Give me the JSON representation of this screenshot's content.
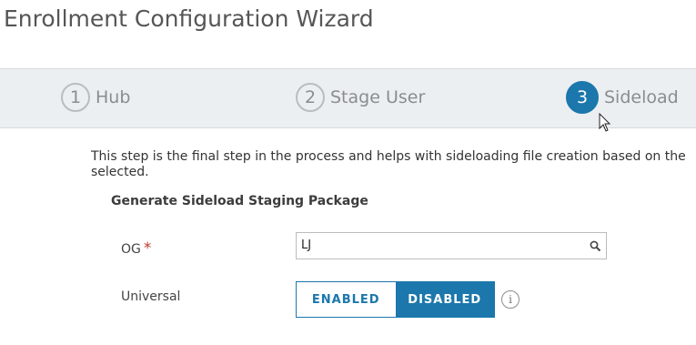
{
  "page": {
    "title": "Enrollment Configuration Wizard"
  },
  "steps": [
    {
      "number": "1",
      "label": "Hub",
      "state": "inactive"
    },
    {
      "number": "2",
      "label": "Stage User",
      "state": "inactive"
    },
    {
      "number": "3",
      "label": "Sideload",
      "state": "active"
    }
  ],
  "content": {
    "description": "This step is the final step in the process and helps with sideloading file creation based on the selected.",
    "section_title": "Generate Sideload Staging Package",
    "og": {
      "label": "OG",
      "required_marker": "*",
      "value": "LJ",
      "icon": "search-icon"
    },
    "universal": {
      "label": "Universal",
      "options": [
        "ENABLED",
        "DISABLED"
      ],
      "selected": "DISABLED",
      "info_icon": "info-icon",
      "info_glyph": "i"
    }
  },
  "colors": {
    "accent": "#1b77ac",
    "stepbar_bg": "#eceff1",
    "required": "#c0392b"
  }
}
